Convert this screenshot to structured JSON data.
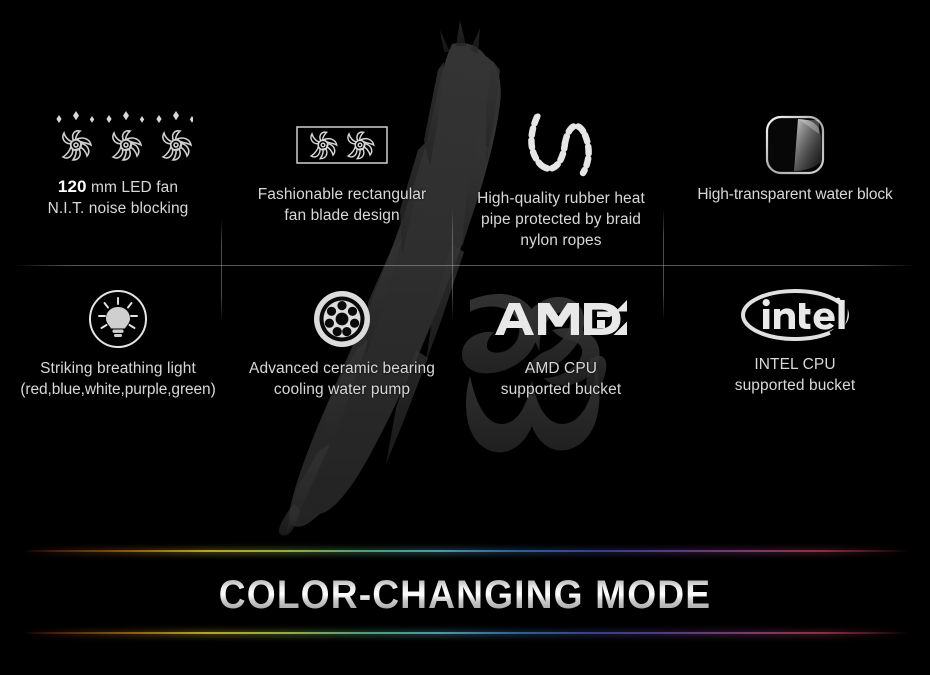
{
  "page": {
    "background_color": "#000000",
    "watermark_text": "Ice",
    "watermark_color": "#2b2b2b"
  },
  "features": {
    "row1": [
      {
        "icon": "triple-led-fan-icon",
        "line1_prefix": "120",
        "line1_rest": " mm LED fan",
        "line2": "N.I.T. noise blocking"
      },
      {
        "icon": "rectangular-dual-fan-icon",
        "line1": "Fashionable rectangular",
        "line2": "fan blade design"
      },
      {
        "icon": "braided-rubber-hose-icon",
        "line1": "High-quality rubber heat",
        "line2": "pipe protected by braid",
        "line3": "nylon ropes"
      },
      {
        "icon": "transparent-water-block-icon",
        "line1": "High-transparent water block"
      }
    ],
    "row2": [
      {
        "icon": "breathing-light-bulb-icon",
        "line1": "Striking breathing light",
        "line2": "(red,blue,white,purple,green)"
      },
      {
        "icon": "ceramic-bearing-pump-icon",
        "line1": "Advanced ceramic bearing",
        "line2": "cooling water pump"
      },
      {
        "icon": "amd-logo-icon",
        "line1": "AMD CPU",
        "line2": "supported bucket"
      },
      {
        "icon": "intel-logo-icon",
        "line1": "INTEL CPU",
        "line2": "supported bucket"
      }
    ]
  },
  "banner": {
    "title": "COLOR-CHANGING MODE",
    "rgb_gradient_colors": [
      "#4a1f0c",
      "#8a5a10",
      "#b8a32a",
      "#8fae46",
      "#4f9d7a",
      "#4f97aa",
      "#2f5f93",
      "#3a3f86",
      "#5a3a7e",
      "#7c3a6c",
      "#8a2f44"
    ]
  }
}
